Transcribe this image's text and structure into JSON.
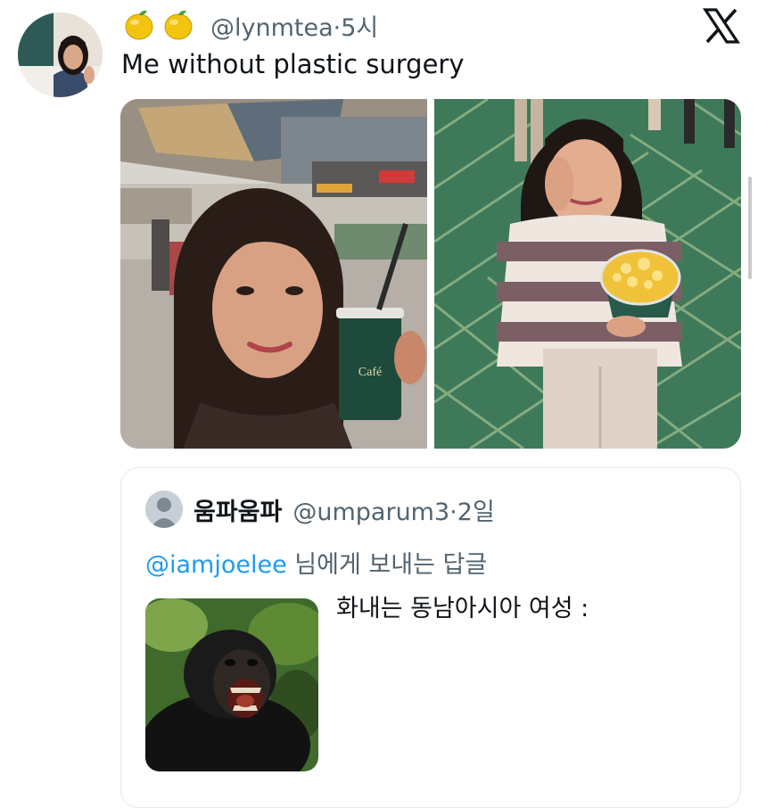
{
  "tweet": {
    "emoji_names": [
      "lemon-emoji",
      "lemon-emoji"
    ],
    "handle": "@lynmtea",
    "separator": "·",
    "time": "5시",
    "text": "Me without plastic surgery"
  },
  "quote": {
    "display_name": "움파움파",
    "handle": "@umparum3",
    "separator": "·",
    "time": "2일",
    "reply_mention": "@iamjoelee",
    "reply_suffix": " 님에게 보내는 답글",
    "text": "화내는 동남아시아 여성 :"
  },
  "icons": {
    "brand": "x-logo-icon",
    "avatar": "avatar-photo",
    "quote_avatar": "default-person-icon"
  },
  "colors": {
    "text": "#0f1419",
    "secondary": "#536471",
    "link": "#1d9bf0",
    "border": "#e6e9ec"
  }
}
